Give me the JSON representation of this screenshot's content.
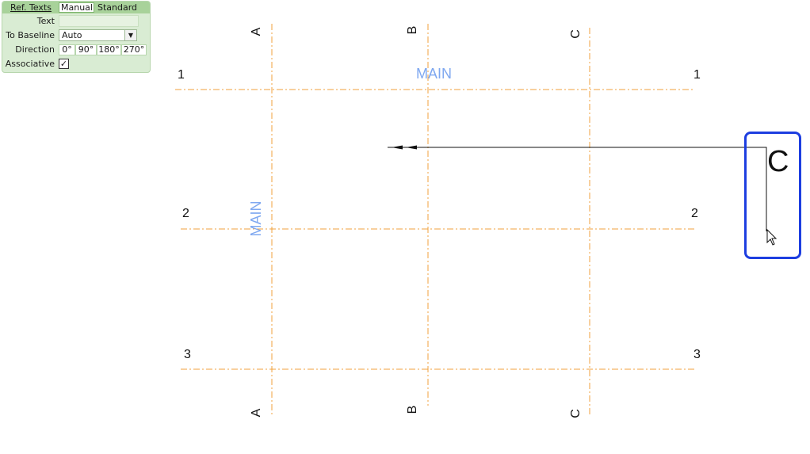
{
  "panel": {
    "tabs": {
      "ref_texts": "Ref. Texts",
      "manual": "Manual",
      "standard": "Standard"
    },
    "rows": {
      "text_label": "Text",
      "baseline_label": "To Baseline",
      "baseline_value": "Auto",
      "direction_label": "Direction",
      "direction_options": [
        "0°",
        "90°",
        "180°",
        "270°"
      ],
      "associative_label": "Associative",
      "associative_checked": "✓"
    }
  },
  "grid": {
    "columns": [
      "A",
      "B",
      "C"
    ],
    "rows": [
      "1",
      "2",
      "3"
    ],
    "horizontal_name": "MAIN",
    "vertical_name": "MAIN",
    "line_color": "#f0a23c",
    "name_color": "#7fa8f0"
  },
  "preview": {
    "letter": "C",
    "border_color": "#1d3ee0"
  }
}
